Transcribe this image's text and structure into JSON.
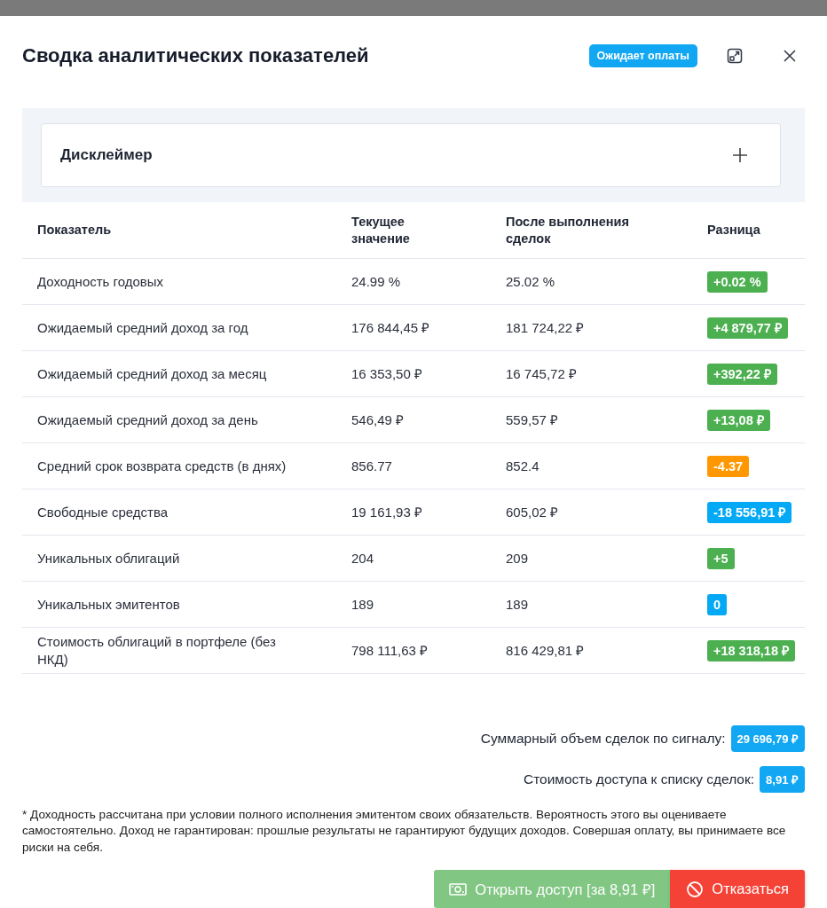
{
  "dialog": {
    "title": "Сводка аналитических показателей",
    "status_badge": "Ожидает оплаты"
  },
  "disclaimer": {
    "title": "Дисклеймер",
    "expanded": false
  },
  "table": {
    "columns": [
      "Показатель",
      "Текущее значение",
      "После выполнения сделок",
      "Разница"
    ],
    "rows": [
      {
        "name": "Доходность годовых",
        "current": "24.99 %",
        "after": "25.02 %",
        "diff": "+0.02 %",
        "color": "#4caf50"
      },
      {
        "name": "Ожидаемый средний доход за год",
        "current": "176 844,45 ₽",
        "after": "181 724,22 ₽",
        "diff": "+4 879,77 ₽",
        "color": "#4caf50"
      },
      {
        "name": "Ожидаемый средний доход за месяц",
        "current": "16 353,50 ₽",
        "after": "16 745,72 ₽",
        "diff": "+392,22 ₽",
        "color": "#4caf50"
      },
      {
        "name": "Ожидаемый средний доход за день",
        "current": "546,49 ₽",
        "after": "559,57 ₽",
        "diff": "+13,08 ₽",
        "color": "#4caf50"
      },
      {
        "name": "Средний срок возврата средств (в днях)",
        "current": "856.77",
        "after": "852.4",
        "diff": "-4.37",
        "color": "#ff9800"
      },
      {
        "name": "Свободные средства",
        "current": "19 161,93 ₽",
        "after": "605,02 ₽",
        "diff": "-18 556,91 ₽",
        "color": "#03a9f4"
      },
      {
        "name": "Уникальных облигаций",
        "current": "204",
        "after": "209",
        "diff": "+5",
        "color": "#4caf50"
      },
      {
        "name": "Уникальных эмитентов",
        "current": "189",
        "after": "189",
        "diff": "0",
        "color": "#03a9f4"
      },
      {
        "name": "Стоимость облигаций в портфеле (без НКД)",
        "current": "798 111,63 ₽",
        "after": "816 429,81 ₽",
        "diff": "+18 318,18 ₽",
        "color": "#4caf50"
      }
    ]
  },
  "summary": [
    {
      "label": "Суммарный объем сделок по сигналу:",
      "value": "29 696,79 ₽"
    },
    {
      "label": "Стоимость доступа к списку сделок:",
      "value": "8,91 ₽"
    }
  ],
  "footnote": "* Доходность рассчитана при условии полного исполнения эмитентом своих обязательств. Вероятность этого вы оцениваете самостоятельно. Доход не гарантирован: прошлые результаты не гарантируют будущих доходов. Совершая оплату, вы принимаете все риски на себя.",
  "buttons": [
    {
      "kind": "pay",
      "label": "Открыть доступ [за 8,91 ₽]",
      "disabled": true
    },
    {
      "kind": "decline",
      "label": "Отказаться",
      "disabled": false
    }
  ]
}
